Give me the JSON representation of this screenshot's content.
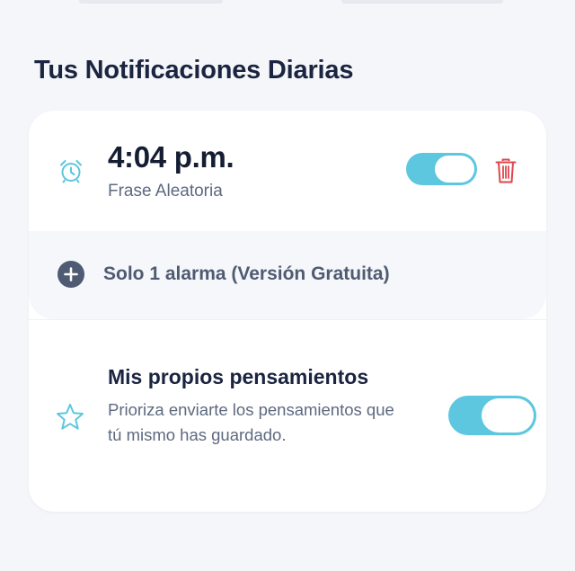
{
  "section": {
    "title": "Tus Notificaciones Diarias"
  },
  "alarm": {
    "time": "4:04 p.m.",
    "subtitle": "Frase Aleatoria",
    "enabled": true,
    "icon": "alarm-clock-icon",
    "delete_icon": "trash-icon"
  },
  "add_alarm": {
    "icon": "plus-circle-icon",
    "label": "Solo 1 alarma (Versión Gratuita)"
  },
  "own_thoughts": {
    "icon": "star-icon",
    "title": "Mis propios pensamientos",
    "description": "Prioriza enviarte los pensamientos que tú mismo has guardado.",
    "enabled": true
  },
  "colors": {
    "accent": "#5cc7de",
    "delete": "#e0464b",
    "background": "#f4f6f9",
    "card": "#ffffff"
  }
}
